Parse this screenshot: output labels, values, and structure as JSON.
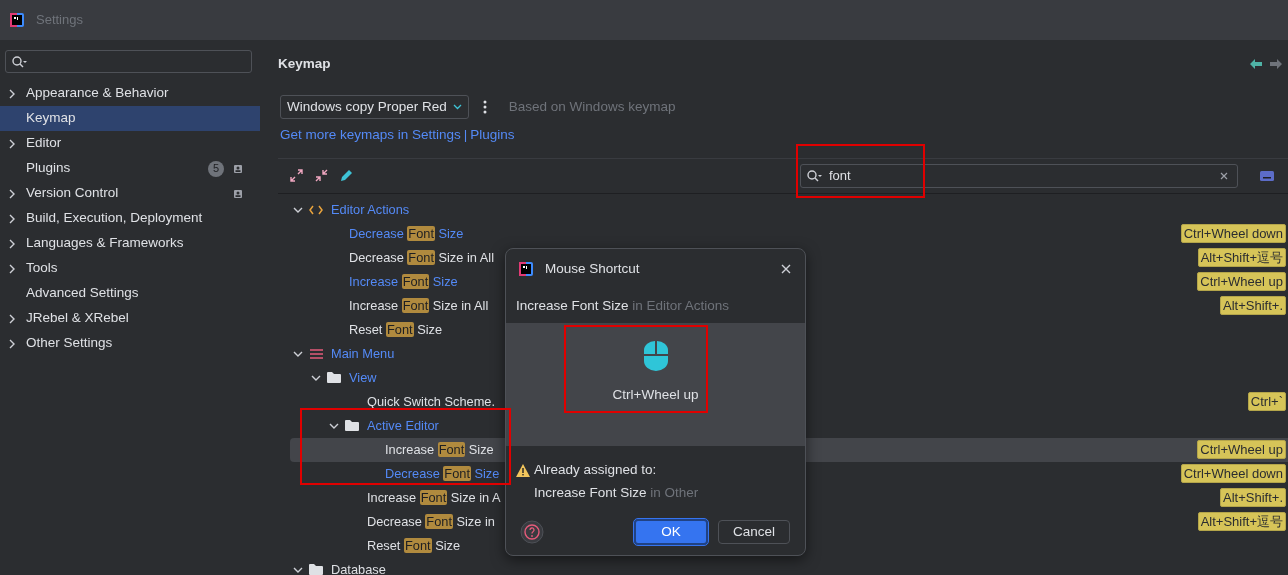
{
  "window": {
    "title": "Settings"
  },
  "sidebar": {
    "items": [
      {
        "label": "Appearance & Behavior",
        "expandable": true,
        "selected": false
      },
      {
        "label": "Keymap",
        "expandable": false,
        "selected": true
      },
      {
        "label": "Editor",
        "expandable": true,
        "selected": false
      },
      {
        "label": "Plugins",
        "expandable": false,
        "selected": false,
        "badge": "5",
        "project_icon": true
      },
      {
        "label": "Version Control",
        "expandable": true,
        "selected": false,
        "project_icon": true
      },
      {
        "label": "Build, Execution, Deployment",
        "expandable": true,
        "selected": false
      },
      {
        "label": "Languages & Frameworks",
        "expandable": true,
        "selected": false
      },
      {
        "label": "Tools",
        "expandable": true,
        "selected": false
      },
      {
        "label": "Advanced Settings",
        "expandable": false,
        "selected": false
      },
      {
        "label": "JRebel & XRebel",
        "expandable": true,
        "selected": false
      },
      {
        "label": "Other Settings",
        "expandable": true,
        "selected": false
      }
    ]
  },
  "page": {
    "title": "Keymap",
    "keymap_select": "Windows copy Proper Red",
    "based_on": "Based on Windows keymap",
    "links": [
      {
        "text": "Get more keymaps in Settings"
      },
      {
        "text": "Plugins"
      }
    ],
    "link_separator": "|",
    "search": {
      "value": "font"
    }
  },
  "tree": [
    {
      "kind": "code",
      "label": {
        "before": "Editor Actions"
      },
      "modified": true,
      "expanded": true,
      "children": [
        {
          "kind": "action",
          "label": {
            "before": "Decrease ",
            "match": "Font",
            "after": " Size"
          },
          "modified": true,
          "selected": false,
          "shortcut": "Ctrl+Wheel down"
        },
        {
          "kind": "action",
          "label": {
            "before": "Decrease ",
            "match": "Font",
            "after": " Size in All"
          },
          "modified": false,
          "selected": false,
          "shortcut": "Alt+Shift+逗号"
        },
        {
          "kind": "action",
          "label": {
            "before": "Increase ",
            "match": "Font",
            "after": " Size"
          },
          "modified": true,
          "selected": false,
          "shortcut": "Ctrl+Wheel up"
        },
        {
          "kind": "action",
          "label": {
            "before": "Increase ",
            "match": "Font",
            "after": " Size in All"
          },
          "modified": false,
          "selected": false,
          "shortcut": "Alt+Shift+."
        },
        {
          "kind": "action",
          "label": {
            "before": "Reset ",
            "match": "Font",
            "after": " Size"
          },
          "modified": false,
          "selected": false
        }
      ]
    },
    {
      "kind": "menu",
      "label": {
        "before": "Main Menu"
      },
      "modified": true,
      "expanded": true,
      "children": [
        {
          "kind": "folder",
          "label": {
            "before": "View"
          },
          "modified": true,
          "expanded": true,
          "children": [
            {
              "kind": "action",
              "label": {
                "before": "Quick Switch Scheme."
              },
              "modified": false,
              "selected": false,
              "shortcut": "Ctrl+`"
            },
            {
              "kind": "folder",
              "label": {
                "before": "Active Editor"
              },
              "modified": true,
              "expanded": true,
              "children": [
                {
                  "kind": "action",
                  "label": {
                    "before": "Increase ",
                    "match": "Font",
                    "after": " Size"
                  },
                  "modified": false,
                  "selected": true,
                  "shortcut": "Ctrl+Wheel up"
                },
                {
                  "kind": "action",
                  "label": {
                    "before": "Decrease ",
                    "match": "Font",
                    "after": " Size"
                  },
                  "modified": true,
                  "selected": false,
                  "shortcut": "Ctrl+Wheel down"
                }
              ]
            },
            {
              "kind": "action",
              "label": {
                "before": "Increase ",
                "match": "Font",
                "after": " Size in A"
              },
              "modified": false,
              "selected": false,
              "shortcut": "Alt+Shift+."
            },
            {
              "kind": "action",
              "label": {
                "before": "Decrease ",
                "match": "Font",
                "after": " Size in"
              },
              "modified": false,
              "selected": false,
              "shortcut": "Alt+Shift+逗号"
            },
            {
              "kind": "action",
              "label": {
                "before": "Reset ",
                "match": "Font",
                "after": " Size"
              },
              "modified": false,
              "selected": false
            }
          ]
        }
      ]
    },
    {
      "kind": "folder",
      "label": {
        "before": "Database"
      },
      "modified": false,
      "expanded": true
    }
  ],
  "dialog": {
    "title": "Mouse Shortcut",
    "action": "Increase Font Size",
    "context": "in Editor Actions",
    "shortcut": "Ctrl+Wheel up",
    "warning": "Already assigned to:",
    "conflict": {
      "action": "Increase Font Size",
      "context": "in Other"
    },
    "buttons": [
      {
        "label": "OK",
        "primary": true
      },
      {
        "label": "Cancel",
        "primary": false
      }
    ]
  }
}
